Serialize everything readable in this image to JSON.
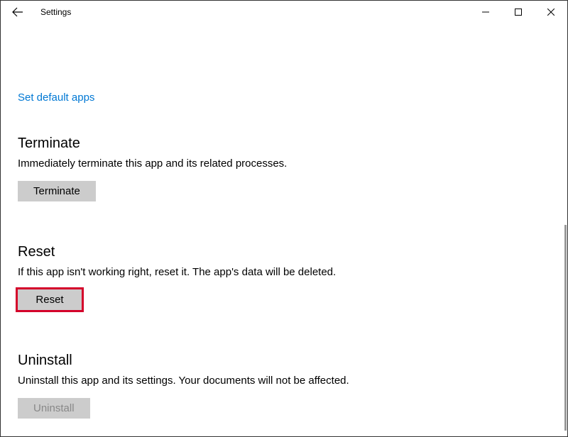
{
  "window": {
    "title": "Settings"
  },
  "link": {
    "set_default_apps": "Set default apps"
  },
  "terminate": {
    "title": "Terminate",
    "description": "Immediately terminate this app and its related processes.",
    "button_label": "Terminate"
  },
  "reset": {
    "title": "Reset",
    "description": "If this app isn't working right, reset it. The app's data will be deleted.",
    "button_label": "Reset"
  },
  "uninstall": {
    "title": "Uninstall",
    "description": "Uninstall this app and its settings. Your documents will not be affected.",
    "button_label": "Uninstall"
  }
}
